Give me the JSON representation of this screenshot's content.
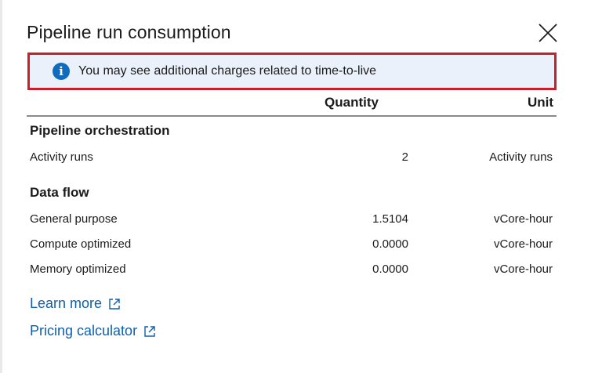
{
  "dialog": {
    "title": "Pipeline run consumption",
    "close_icon": "close-icon"
  },
  "banner": {
    "icon": "info-icon",
    "icon_glyph": "i",
    "text": "You may see additional charges related to time-to-live",
    "border_color": "#c8202a",
    "background_color": "#eaf1fb"
  },
  "table": {
    "headers": {
      "quantity": "Quantity",
      "unit": "Unit"
    },
    "sections": [
      {
        "title": "Pipeline orchestration",
        "rows": [
          {
            "name": "Activity runs",
            "quantity": "2",
            "unit": "Activity runs"
          }
        ]
      },
      {
        "title": "Data flow",
        "rows": [
          {
            "name": "General purpose",
            "quantity": "1.5104",
            "unit": "vCore-hour"
          },
          {
            "name": "Compute optimized",
            "quantity": "0.0000",
            "unit": "vCore-hour"
          },
          {
            "name": "Memory optimized",
            "quantity": "0.0000",
            "unit": "vCore-hour"
          }
        ]
      }
    ]
  },
  "links": {
    "learn_more": "Learn more",
    "pricing_calculator": "Pricing calculator",
    "link_color": "#0f5fae",
    "external_icon": "external-link-icon"
  }
}
